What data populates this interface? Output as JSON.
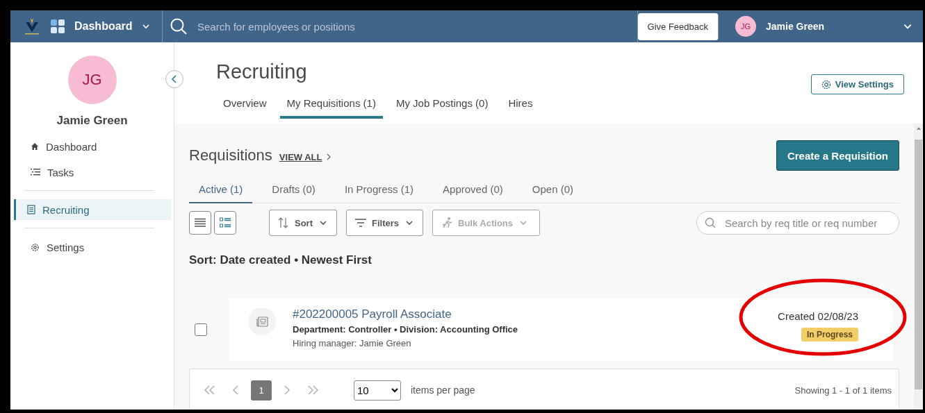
{
  "header": {
    "app_menu": "Dashboard",
    "search_placeholder": "Search for employees or positions",
    "feedback_button": "Give Feedback",
    "user": {
      "initials": "JG",
      "name": "Jamie Green"
    }
  },
  "sidebar": {
    "initials": "JG",
    "name": "Jamie Green",
    "items": [
      {
        "kind": "home",
        "label": "Dashboard",
        "selected": false
      },
      {
        "kind": "tasks",
        "label": "Tasks",
        "selected": false
      },
      {
        "kind": "recruiting",
        "label": "Recruiting",
        "selected": true
      },
      {
        "kind": "settings",
        "label": "Settings",
        "selected": false
      }
    ]
  },
  "page": {
    "title": "Recruiting",
    "view_settings": "View Settings",
    "tabs": [
      {
        "label": "Overview",
        "selected": false
      },
      {
        "label": "My Requisitions (1)",
        "selected": true
      },
      {
        "label": "My Job Postings (0)",
        "selected": false
      },
      {
        "label": "Hires",
        "selected": false
      }
    ]
  },
  "requisitions": {
    "title": "Requisitions",
    "view_all": "VIEW ALL",
    "create_button": "Create a Requisition",
    "status_tabs": [
      {
        "label": "Active (1)",
        "selected": true
      },
      {
        "label": "Drafts (0)",
        "selected": false
      },
      {
        "label": "In Progress (1)",
        "selected": false
      },
      {
        "label": "Approved (0)",
        "selected": false
      },
      {
        "label": "Open (0)",
        "selected": false
      }
    ],
    "view_modes": [
      {
        "kind": "list",
        "selected": false
      },
      {
        "kind": "cards",
        "selected": true
      }
    ],
    "sort_button": "Sort",
    "filters_button": "Filters",
    "bulk_actions": {
      "label": "Bulk Actions",
      "disabled": true
    },
    "search_placeholder": "Search by req title or req number",
    "sort_summary": "Sort: Date created • Newest First",
    "items": [
      {
        "checked": false,
        "title": "#202200005 Payroll Associate",
        "details": "Department: Controller • Division: Accounting Office",
        "manager": "Hiring manager: Jamie Green",
        "created": "Created 02/08/23",
        "status": {
          "label": "In Progress",
          "color": "#f2cd68"
        },
        "highlighted": true
      }
    ],
    "pagination": {
      "page": "1",
      "per_page": "10",
      "per_page_label": "items per page",
      "showing": "Showing 1 - 1 of 1 items"
    }
  }
}
